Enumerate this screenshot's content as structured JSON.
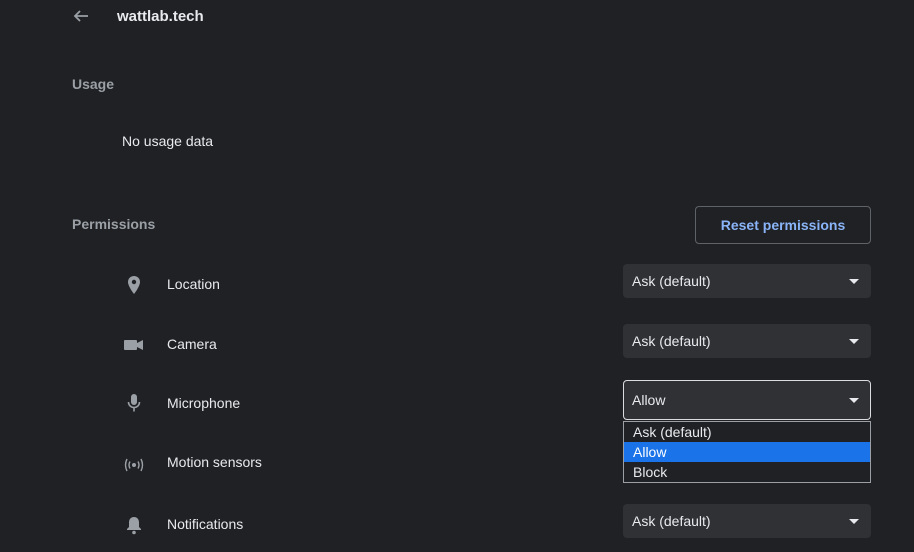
{
  "header": {
    "back_icon": "arrow-back-icon",
    "title": "wattlab.tech"
  },
  "usage": {
    "label": "Usage",
    "text": "No usage data"
  },
  "permissions": {
    "label": "Permissions",
    "reset_label": "Reset permissions",
    "items": [
      {
        "icon": "location-pin-icon",
        "label": "Location",
        "value": "Ask (default)"
      },
      {
        "icon": "camera-icon",
        "label": "Camera",
        "value": "Ask (default)"
      },
      {
        "icon": "microphone-icon",
        "label": "Microphone",
        "value": "Allow"
      },
      {
        "icon": "motion-sensors-icon",
        "label": "Motion sensors",
        "value": ""
      },
      {
        "icon": "bell-icon",
        "label": "Notifications",
        "value": "Ask (default)"
      }
    ]
  },
  "dropdown": {
    "options": [
      "Ask (default)",
      "Allow",
      "Block"
    ],
    "selected": "Allow"
  },
  "colors": {
    "background": "#202124",
    "accent": "#8ab4f8",
    "selection": "#1a73e8"
  }
}
